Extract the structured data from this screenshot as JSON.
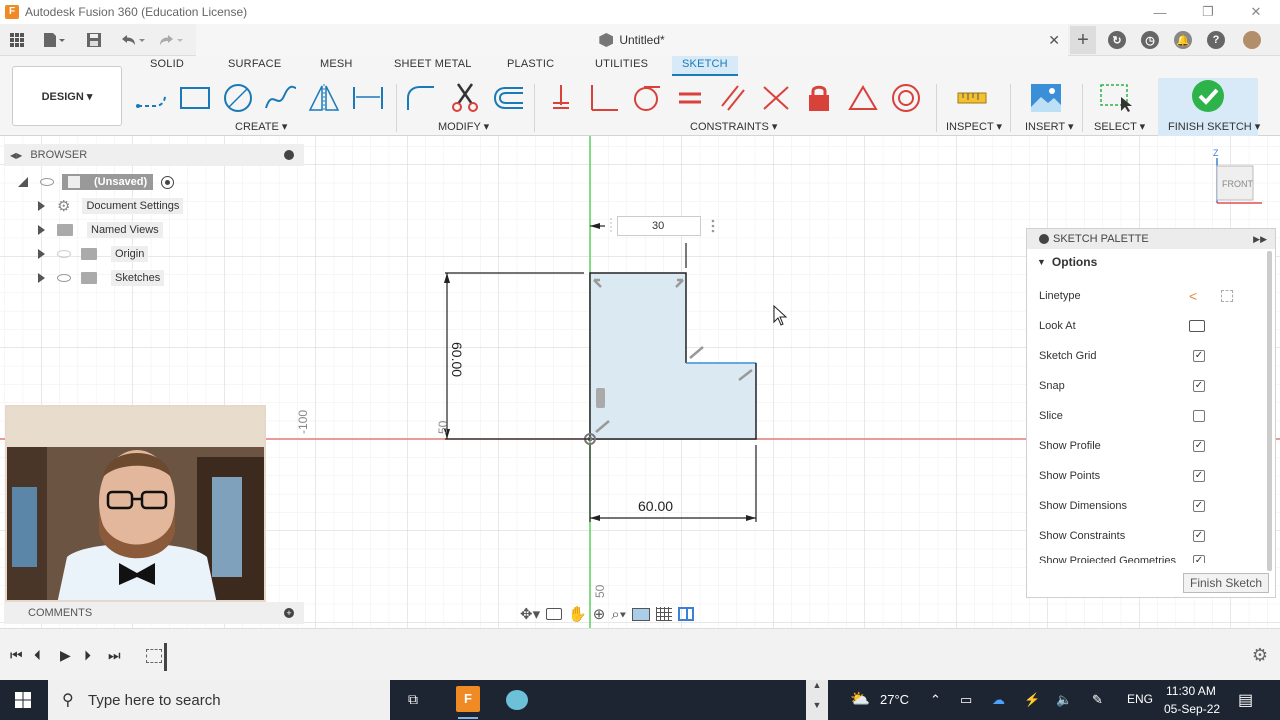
{
  "window": {
    "title": "Autodesk Fusion 360 (Education License)",
    "logo": "F"
  },
  "app_toolbar": {
    "document_name": "Untitled*",
    "icons": [
      "apps-grid-icon",
      "file-icon",
      "save-icon",
      "undo-icon",
      "redo-icon",
      "plus-icon",
      "sync-icon",
      "history-icon",
      "notifications-icon",
      "help-icon",
      "user-avatar"
    ]
  },
  "ribbon": {
    "workspace": "DESIGN ▾",
    "tabs": [
      "SOLID",
      "SURFACE",
      "MESH",
      "SHEET METAL",
      "PLASTIC",
      "UTILITIES",
      "SKETCH"
    ],
    "active_tab": "SKETCH",
    "groups": {
      "create": "CREATE ▾",
      "modify": "MODIFY ▾",
      "constraints": "CONSTRAINTS ▾",
      "inspect": "INSPECT ▾",
      "insert": "INSERT ▾",
      "select": "SELECT ▾",
      "finish": "FINISH SKETCH ▾"
    },
    "colors": {
      "accent": "#1a7ab8",
      "finish_green": "#2db34a",
      "constraint_red": "#d9413b"
    }
  },
  "browser": {
    "title": "BROWSER",
    "root": "(Unsaved)",
    "items": [
      "Document Settings",
      "Named Views",
      "Origin",
      "Sketches"
    ]
  },
  "comments": {
    "title": "COMMENTS"
  },
  "sketch": {
    "dimension_input": "30",
    "dim_60_horizontal": "60.00",
    "dim_60_vertical": "60.00",
    "axis_label_left": "-100",
    "axis_label_mid": "50",
    "axis_label_bottom": "50",
    "view_cube": "FRONT",
    "axis_z": "Z"
  },
  "palette": {
    "title": "SKETCH PALETTE",
    "section": "Options",
    "rows": [
      {
        "label": "Linetype",
        "kind": "icons"
      },
      {
        "label": "Look At",
        "kind": "icon"
      },
      {
        "label": "Sketch Grid",
        "checked": true
      },
      {
        "label": "Snap",
        "checked": true
      },
      {
        "label": "Slice",
        "checked": false
      },
      {
        "label": "Show Profile",
        "checked": true
      },
      {
        "label": "Show Points",
        "checked": true
      },
      {
        "label": "Show Dimensions",
        "checked": true
      },
      {
        "label": "Show Constraints",
        "checked": true
      },
      {
        "label": "Show Projected Geometries",
        "checked": true
      }
    ],
    "finish_button": "Finish Sketch"
  },
  "taskbar": {
    "search_placeholder": "Type here to search",
    "weather": "27°C",
    "language": "ENG",
    "time": "11:30 AM",
    "date": "05-Sep-22"
  }
}
